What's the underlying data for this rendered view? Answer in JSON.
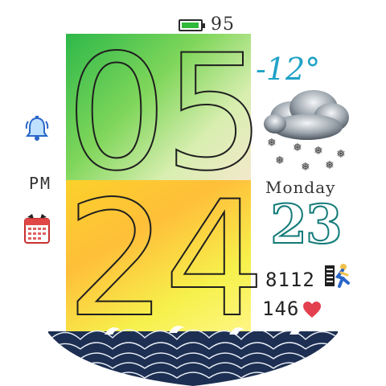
{
  "status": {
    "battery_percent": 95,
    "battery_label": "95",
    "battery_color": "#31b83a"
  },
  "time": {
    "hour": "05",
    "minute": "24",
    "period": "PM"
  },
  "weather": {
    "temperature": "-12°",
    "condition_icon": "snow-cloud-icon",
    "temp_color": "#1fa2c7"
  },
  "date": {
    "weekday": "Monday",
    "day": "23"
  },
  "activity": {
    "steps": "8112",
    "steps_icon": "runner-icon",
    "heart_rate": "146",
    "heart_icon": "heart-icon"
  },
  "shortcuts": {
    "alarm_icon": "alarm-bell-icon",
    "calendar_icon": "calendar-icon"
  },
  "colors": {
    "hour_gradient": [
      "#2db84a",
      "#f7e7cf"
    ],
    "minute_gradient": [
      "#fbd12a",
      "#fff68a"
    ],
    "date_outline": "#127a78",
    "heart": "#e34050",
    "wave": "#1d2f52"
  }
}
